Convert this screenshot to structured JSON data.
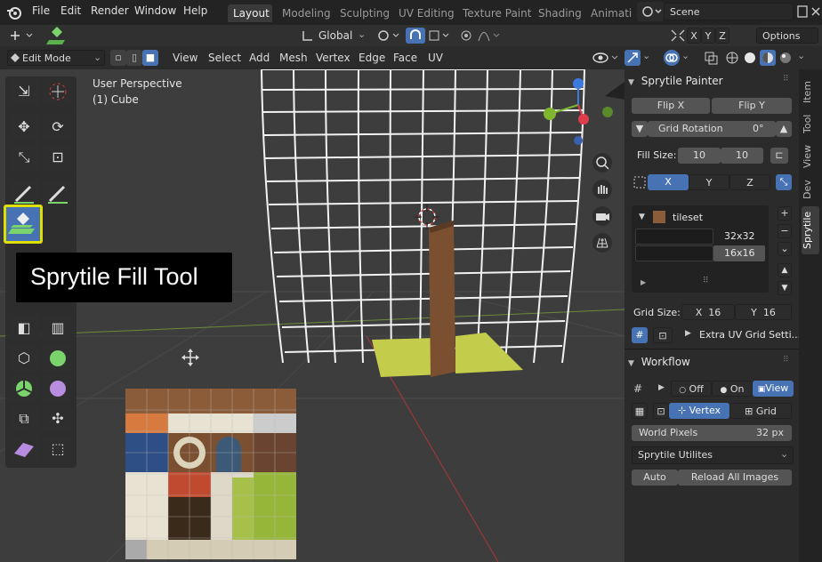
{
  "menu": {
    "file": "File",
    "edit": "Edit",
    "render": "Render",
    "window": "Window",
    "help": "Help"
  },
  "workspaces": [
    "Layout",
    "Modeling",
    "Sculpting",
    "UV Editing",
    "Texture Paint",
    "Shading",
    "Animatio"
  ],
  "scene": {
    "label": "Scene"
  },
  "toolbar": {
    "orientation": "Global",
    "axes": [
      "X",
      "Y",
      "Z"
    ],
    "options": "Options"
  },
  "mode_header": {
    "mode": "Edit Mode",
    "menus": [
      "View",
      "Select",
      "Add",
      "Mesh",
      "Vertex",
      "Edge",
      "Face",
      "UV"
    ]
  },
  "viewport": {
    "perspective": "User Perspective",
    "object": "(1) Cube",
    "tooltip": "Sprytile Fill Tool"
  },
  "colors": {
    "accent": "#4772b3",
    "highlight": "#e0e000",
    "grid_line": "#f2f2f2",
    "axis_red": "#e03c4c",
    "axis_green": "#7fb630",
    "axis_blue": "#3c7ae0"
  },
  "sidebar": {
    "tabs": [
      "Item",
      "Tool",
      "View",
      "Dev",
      "Sprytile"
    ],
    "painter": {
      "title": "Sprytile Painter",
      "flip_x": "Flip X",
      "flip_y": "Flip Y",
      "grid_rotation_label": "Grid Rotation",
      "grid_rotation_value": "0°",
      "fill_size_label": "Fill Size:",
      "fill_w": "10",
      "fill_h": "10",
      "axis": [
        "X",
        "Y",
        "Z"
      ],
      "tileset_name": "tileset",
      "tile_sizes": [
        "32x32",
        "16x16"
      ],
      "grid_size_label": "Grid Size:",
      "grid_x_label": "X",
      "grid_x": "16",
      "grid_y_label": "Y",
      "grid_y": "16",
      "extra_uv": "Extra UV Grid Setti..."
    },
    "workflow": {
      "title": "Workflow",
      "off": "Off",
      "on": "On",
      "view": "View",
      "vertex": "Vertex",
      "grid": "Grid",
      "world_pixels_label": "World Pixels",
      "world_pixels_value": "32 px",
      "utilities": "Sprytile Utilites",
      "auto": "Auto",
      "reload": "Reload All Images"
    }
  }
}
